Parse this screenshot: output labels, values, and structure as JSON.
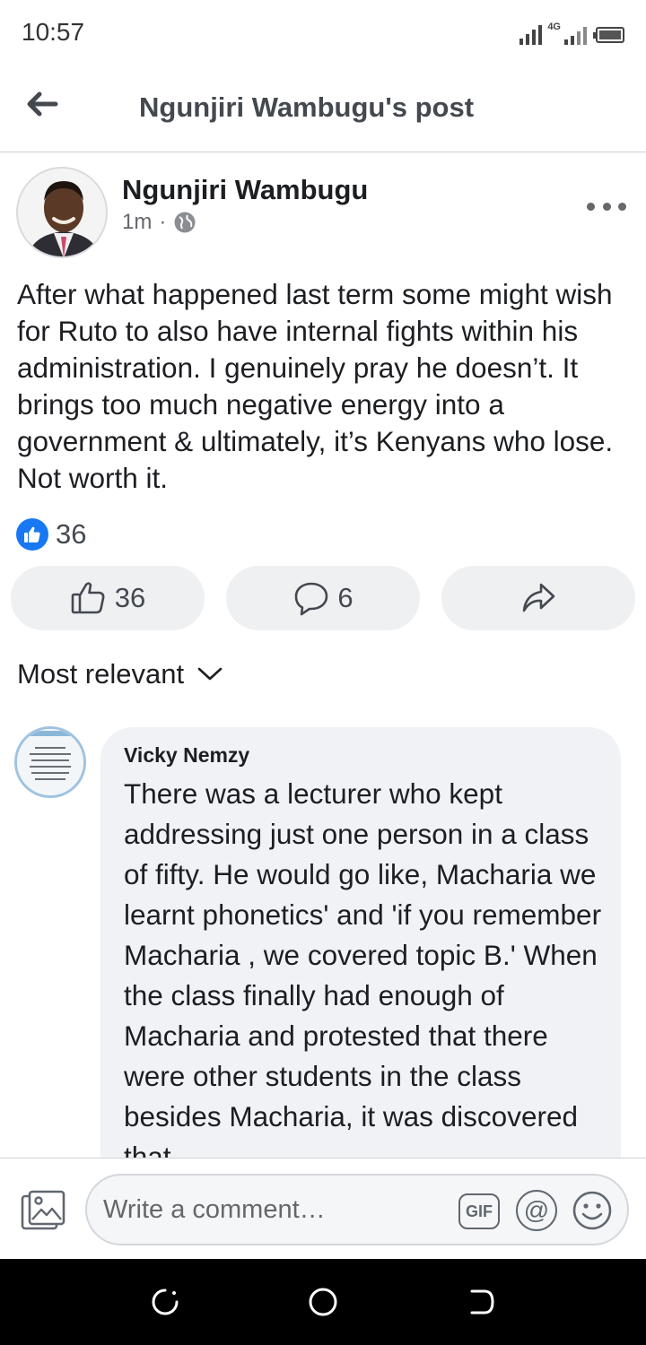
{
  "status_bar": {
    "time": "10:57",
    "network": "4G"
  },
  "header": {
    "title": "Ngunjiri Wambugu's post"
  },
  "post": {
    "author": "Ngunjiri Wambugu",
    "time": "1m",
    "separator": "·",
    "privacy_icon": "globe-icon",
    "text": "After what happened last term some might wish for Ruto to also have internal fights within his administration. I genuinely pray he doesn’t. It brings too much negative energy into a government & ultimately, it’s Kenyans who lose. Not worth it.",
    "reaction_count": "36"
  },
  "actions": {
    "like_count": "36",
    "comment_count": "6"
  },
  "comments_sort": {
    "label": "Most relevant"
  },
  "comment": {
    "author": "Vicky Nemzy",
    "text": "There was a lecturer who kept addressing just one person in a class of fifty. He would go like, Macharia we learnt phonetics' and 'if you remember Macharia , we covered topic B.' When the class finally had enough of Macharia and protested that there were other students in the class besides Macharia, it was discovered that"
  },
  "composer": {
    "placeholder": "Write a comment…",
    "gif_label": "GIF",
    "mention_label": "@"
  },
  "colors": {
    "accent": "#1877f2",
    "text": "#1c1e21",
    "secondary": "#65676b",
    "bubble": "#f0f2f5"
  }
}
